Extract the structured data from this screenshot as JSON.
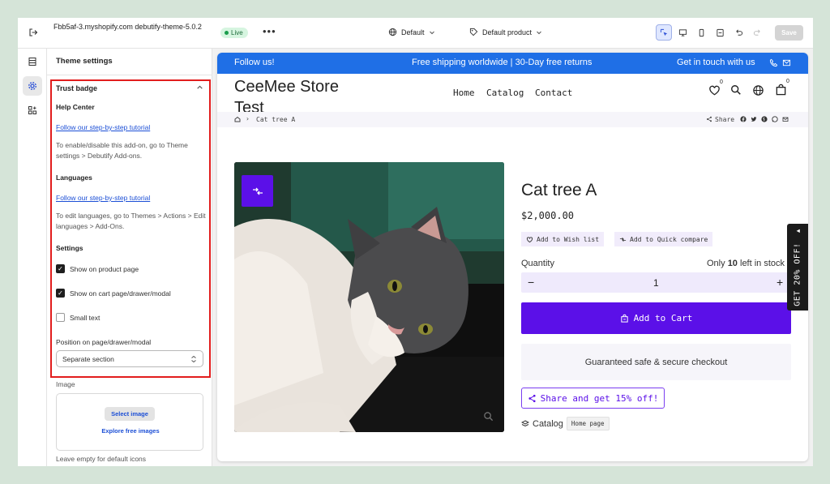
{
  "topbar": {
    "store_name": "Fbb5af-3.myshopify.com debutify-theme-5.0.2",
    "live_badge": "Live",
    "template_select": "Default",
    "product_select": "Default product",
    "save_label": "Save"
  },
  "sidebar": {
    "title": "Theme settings",
    "section_title": "Trust badge",
    "help_center_heading": "Help Center",
    "help_center_link": "Follow our step-by-step tutorial",
    "help_center_note": "To enable/disable this add-on, go to Theme settings > Debutify Add-ons.",
    "languages_heading": "Languages",
    "languages_link": "Follow our step-by-step tutorial",
    "languages_note": "To edit languages, go to Themes > Actions > Edit languages > Add-Ons.",
    "settings_heading": "Settings",
    "checkboxes": [
      {
        "label": "Show on product page",
        "checked": true
      },
      {
        "label": "Show on cart page/drawer/modal",
        "checked": true
      },
      {
        "label": "Small text",
        "checked": false
      }
    ],
    "position_label": "Position on page/drawer/modal",
    "position_value": "Separate section",
    "image_label": "Image",
    "select_image_button": "Select image",
    "explore_images_link": "Explore free images",
    "image_hint": "Leave empty for default icons"
  },
  "preview": {
    "announcement": {
      "left": "Follow us!",
      "center": "Free shipping worldwide | 30-Day free returns",
      "right": "Get in touch with us"
    },
    "store_logo": "CeeMee Store Test",
    "nav": [
      "Home",
      "Catalog",
      "Contact"
    ],
    "wishlist_count": "0",
    "cart_count": "0",
    "breadcrumb_current": "Cat tree A",
    "share_label": "Share",
    "product": {
      "title": "Cat tree A",
      "price": "$2,000.00",
      "wishlist_label": "Add to Wish list",
      "compare_label": "Add to Quick compare",
      "quantity_label": "Quantity",
      "stock_prefix": "Only",
      "stock_count": "10",
      "stock_suffix": "left in stock",
      "quantity_value": "1",
      "add_to_cart": "Add to Cart",
      "checkout_note": "Guaranteed safe & secure checkout",
      "share_offer": "Share and get 15% off!",
      "catalog_label": "Catalog",
      "catalog_tag": "Home page"
    },
    "side_tab": "GET 20% OFF!"
  },
  "colors": {
    "brand_purple": "#5b10e8",
    "announcement_blue": "#1f6fe6",
    "highlight_red": "#e21d1d",
    "page_background": "#d5e4d8"
  }
}
